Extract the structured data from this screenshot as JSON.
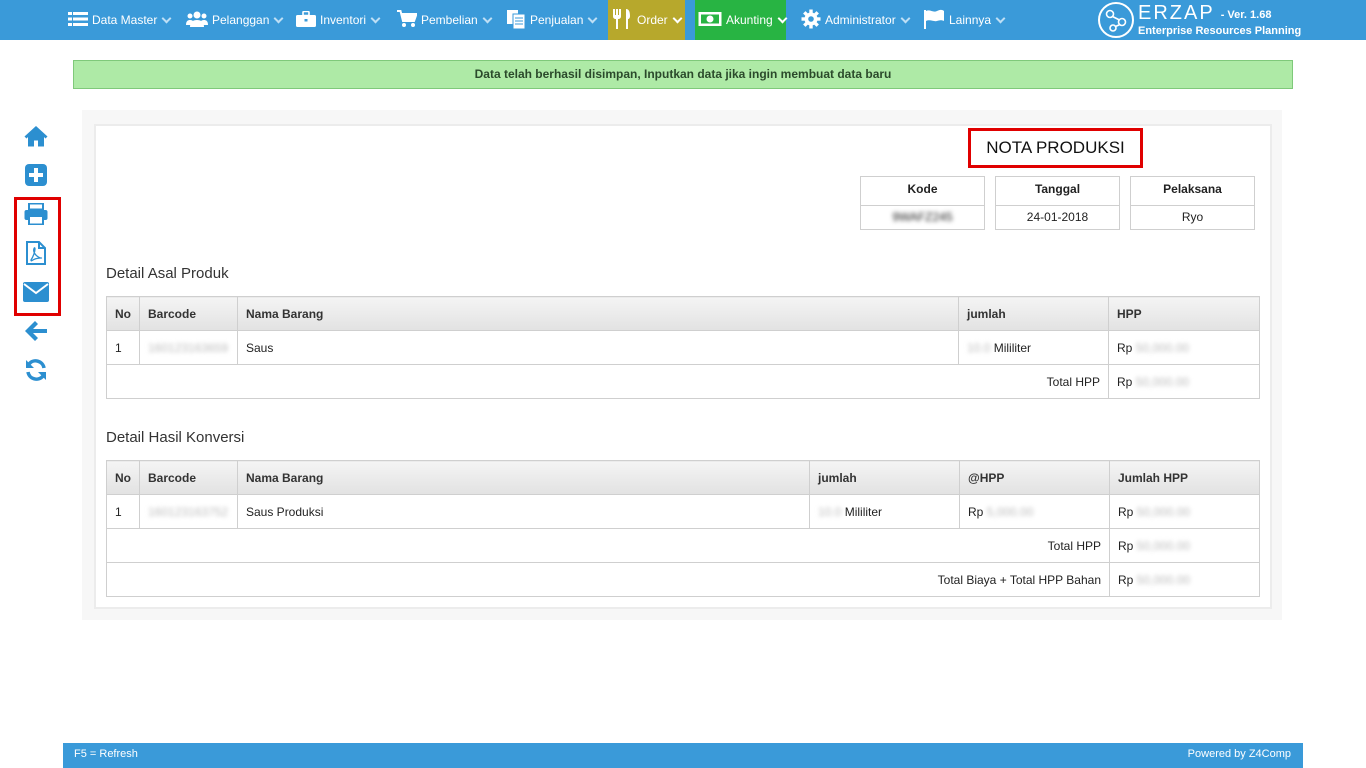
{
  "nav": {
    "items": [
      {
        "label": "Data Master",
        "icon": "list-icon"
      },
      {
        "label": "Pelanggan",
        "icon": "users-icon"
      },
      {
        "label": "Inventori",
        "icon": "briefcase-icon"
      },
      {
        "label": "Pembelian",
        "icon": "cart-icon"
      },
      {
        "label": "Penjualan",
        "icon": "documents-icon"
      },
      {
        "label": "Order",
        "icon": "cutlery-icon"
      },
      {
        "label": "Akunting",
        "icon": "money-icon"
      },
      {
        "label": "Administrator",
        "icon": "gear-icon"
      },
      {
        "label": "Lainnya",
        "icon": "flag-icon"
      }
    ],
    "brand_name": "ERZAP",
    "version": "- Ver. 1.68",
    "tagline": "Enterprise Resources Planning"
  },
  "alert": "Data telah berhasil disimpan, Inputkan data jika ingin membuat data baru",
  "sidebar": [
    "home-icon",
    "plus-square-icon",
    "print-icon",
    "pdf-icon",
    "envelope-icon",
    "arrow-left-icon",
    "refresh-icon"
  ],
  "nota": {
    "title": "NOTA PRODUKSI",
    "kode_label": "Kode",
    "kode_value": "9WAFZ245",
    "tanggal_label": "Tanggal",
    "tanggal_value": "24-01-2018",
    "pelaksana_label": "Pelaksana",
    "pelaksana_value": "Ryo"
  },
  "asal": {
    "title": "Detail Asal Produk",
    "headers": [
      "No",
      "Barcode",
      "Nama Barang",
      "jumlah",
      "HPP"
    ],
    "row": {
      "no": "1",
      "barcode": "160123163659",
      "nama": "Saus",
      "qty": "10.0",
      "unit": "Mililiter",
      "rp": "Rp",
      "hpp": "50,000.00"
    },
    "total_label": "Total HPP",
    "total_rp": "Rp",
    "total_value": "50,000.00"
  },
  "konversi": {
    "title": "Detail Hasil Konversi",
    "headers": [
      "No",
      "Barcode",
      "Nama Barang",
      "jumlah",
      "@HPP",
      "Jumlah HPP"
    ],
    "row": {
      "no": "1",
      "barcode": "160123163752",
      "nama": "Saus Produksi",
      "qty": "10.0",
      "unit": "Mililiter",
      "rp1": "Rp",
      "at_hpp": "5,000.00",
      "rp2": "Rp",
      "jumlah_hpp": "50,000.00"
    },
    "total_label": "Total HPP",
    "total_rp": "Rp",
    "total_value": "50,000.00",
    "grand_label": "Total Biaya + Total HPP Bahan",
    "grand_rp": "Rp",
    "grand_value": "50,000.00"
  },
  "footer": {
    "left": "F5 = Refresh",
    "right": "Powered by Z4Comp"
  }
}
